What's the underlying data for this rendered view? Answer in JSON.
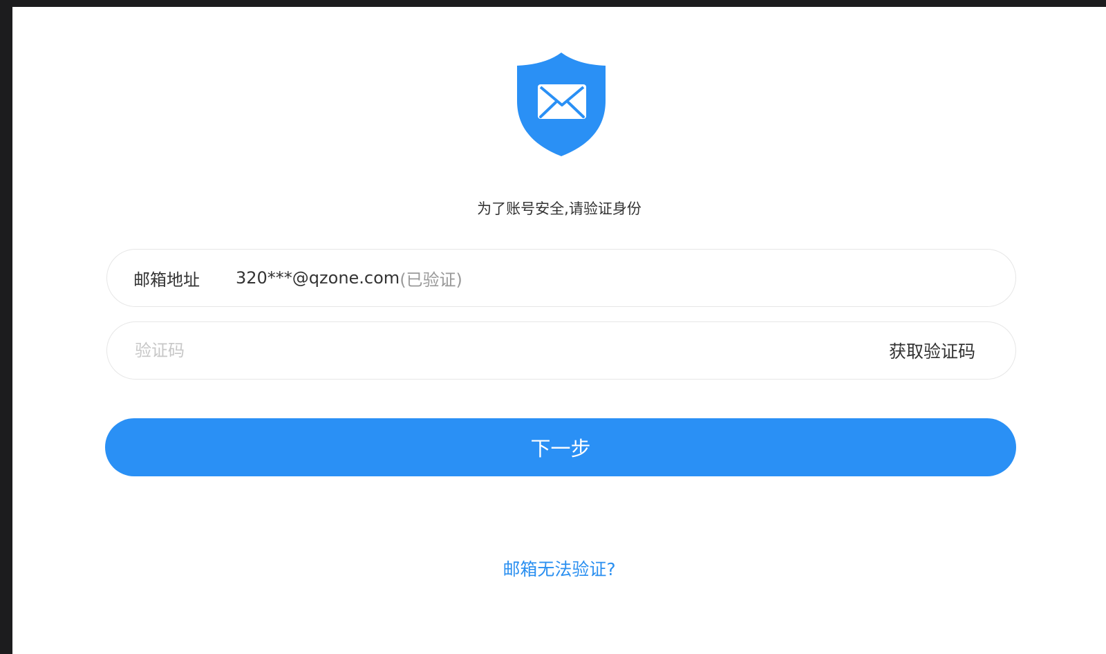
{
  "header": {
    "icon": "mail-shield-icon",
    "subtitle": "为了账号安全,请验证身份"
  },
  "form": {
    "email_label": "邮箱地址",
    "email_value": "320***@qzone.com",
    "email_status": "(已验证)",
    "code_placeholder": "验证码",
    "get_code_label": "获取验证码",
    "next_label": "下一步"
  },
  "footer": {
    "help_link": "邮箱无法验证?"
  },
  "colors": {
    "accent": "#2a90f5",
    "link": "#2a8ff0",
    "text": "#333333",
    "muted": "#999999",
    "border": "#e6e6e6"
  }
}
